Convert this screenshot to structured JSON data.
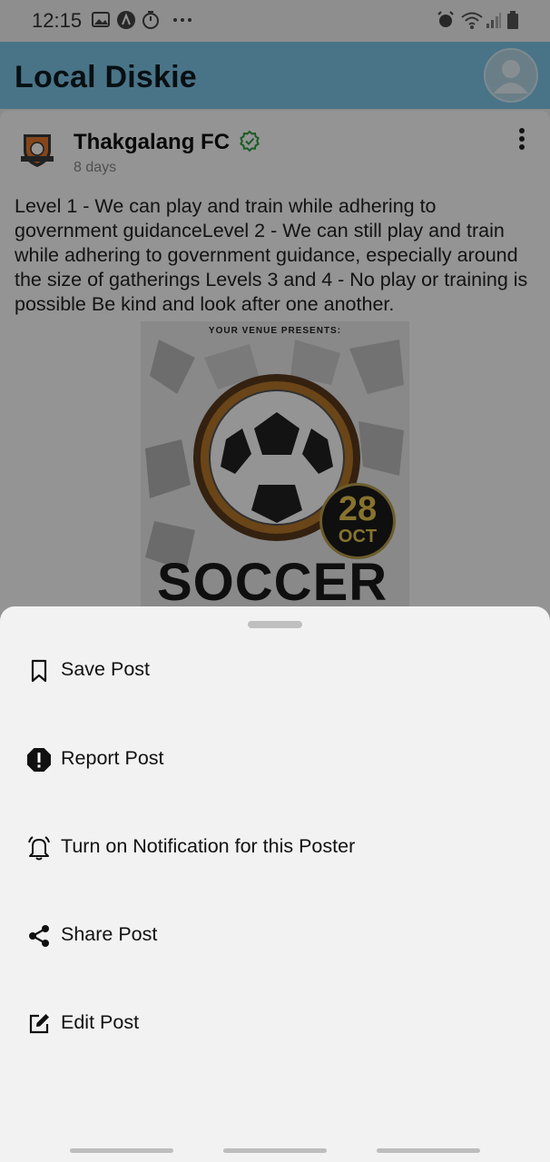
{
  "status_bar": {
    "time": "12:15",
    "left_icons": [
      "gallery-icon",
      "app-icon",
      "timer-icon",
      "more-icon"
    ],
    "right_icons": [
      "alarm-icon",
      "wifi-icon",
      "signal-icon",
      "battery-icon"
    ]
  },
  "app_bar": {
    "title": "Local Diskie",
    "profile_icon": "user-avatar-icon",
    "color": "#7ec8e8"
  },
  "post": {
    "author": "Thakgalang FC",
    "verified_icon": "verified-badge-icon",
    "time": "8 days",
    "body": "Level 1 - We can play and train while adhering to government guidanceLevel 2 - We can still play and train while adhering to government guidance, especially around the size of gatherings Levels 3 and 4 - No play or training is possible Be kind and look after one another.",
    "poster": {
      "tagline": "YOUR VENUE PRESENTS:",
      "day": "28",
      "month": "OCT",
      "headline": "SOCCER"
    }
  },
  "sheet": {
    "options": [
      {
        "label": "Save Post",
        "icon": "bookmark-icon"
      },
      {
        "label": "Report Post",
        "icon": "report-icon"
      },
      {
        "label": "Turn on Notification for this Poster",
        "icon": "bell-icon"
      },
      {
        "label": "Share Post",
        "icon": "share-icon"
      },
      {
        "label": "Edit Post",
        "icon": "edit-icon"
      }
    ]
  },
  "colors": {
    "accent": "#7ec8e8",
    "verified": "#2e9d3e",
    "sheet_bg": "#f2f2f2"
  }
}
